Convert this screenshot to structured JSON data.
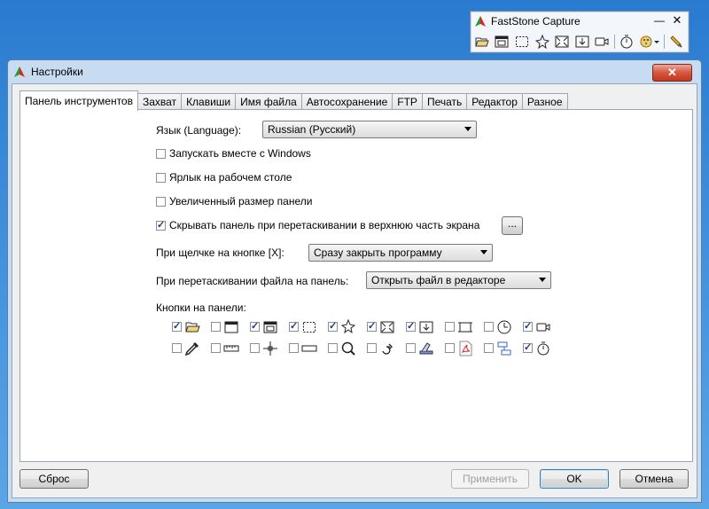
{
  "faststone": {
    "title": "FastStone Capture",
    "minimize_glyph": "—",
    "close_glyph": "✕",
    "tools": [
      "open-icon",
      "capture-window-icon",
      "capture-rect-icon",
      "capture-freehand-icon",
      "capture-fullscreen-icon",
      "capture-scroll-icon",
      "screen-recorder-icon",
      "timer-icon",
      "output-settings-icon",
      "settings-icon"
    ]
  },
  "dialog": {
    "title": "Настройки",
    "close_glyph": "✕",
    "tabs": [
      "Панель инструментов",
      "Захват",
      "Клавиши",
      "Имя файла",
      "Автосохранение",
      "FTP",
      "Печать",
      "Редактор",
      "Разное"
    ],
    "active_tab": 0,
    "language_label": "Язык (Language):",
    "language_value": "Russian (Русский)",
    "options": [
      {
        "label": "Запускать вместе с Windows",
        "checked": false
      },
      {
        "label": "Ярлык на рабочем столе",
        "checked": false
      },
      {
        "label": "Увеличенный размер панели",
        "checked": false
      },
      {
        "label": "Скрывать панель при перетаскивании в верхнюю часть экрана",
        "checked": true
      }
    ],
    "ellipsis_label": "...",
    "close_x_label": "При щелчке на кнопке [X]:",
    "close_x_value": "Сразу закрыть программу",
    "drag_label": "При перетаскивании файла на панель:",
    "drag_value": "Открыть файл в редакторе",
    "buttons_label": "Кнопки на панели:",
    "panel_buttons_row1": [
      {
        "icon": "open-icon",
        "checked": true
      },
      {
        "icon": "capture-active-window-icon",
        "checked": false
      },
      {
        "icon": "capture-window-icon",
        "checked": true
      },
      {
        "icon": "capture-rect-icon",
        "checked": true
      },
      {
        "icon": "capture-freehand-icon",
        "checked": true
      },
      {
        "icon": "capture-fullscreen-icon",
        "checked": true
      },
      {
        "icon": "capture-scroll-icon",
        "checked": true
      },
      {
        "icon": "capture-fixed-region-icon",
        "checked": false
      },
      {
        "icon": "clock-icon",
        "checked": false
      },
      {
        "icon": "screen-recorder-icon",
        "checked": true
      }
    ],
    "panel_buttons_row2": [
      {
        "icon": "color-picker-icon",
        "checked": false
      },
      {
        "icon": "ruler-icon",
        "checked": false
      },
      {
        "icon": "crosshair-icon",
        "checked": false
      },
      {
        "icon": "screen-bar-icon",
        "checked": false
      },
      {
        "icon": "magnifier-icon",
        "checked": false
      },
      {
        "icon": "redo-icon",
        "checked": false
      },
      {
        "icon": "scanner-icon",
        "checked": false
      },
      {
        "icon": "pdf-icon",
        "checked": false
      },
      {
        "icon": "compare-icon",
        "checked": false
      },
      {
        "icon": "timer-icon",
        "checked": true
      }
    ],
    "reset_label": "Сброс",
    "apply_label": "Применить",
    "ok_label": "OK",
    "cancel_label": "Отмена"
  }
}
